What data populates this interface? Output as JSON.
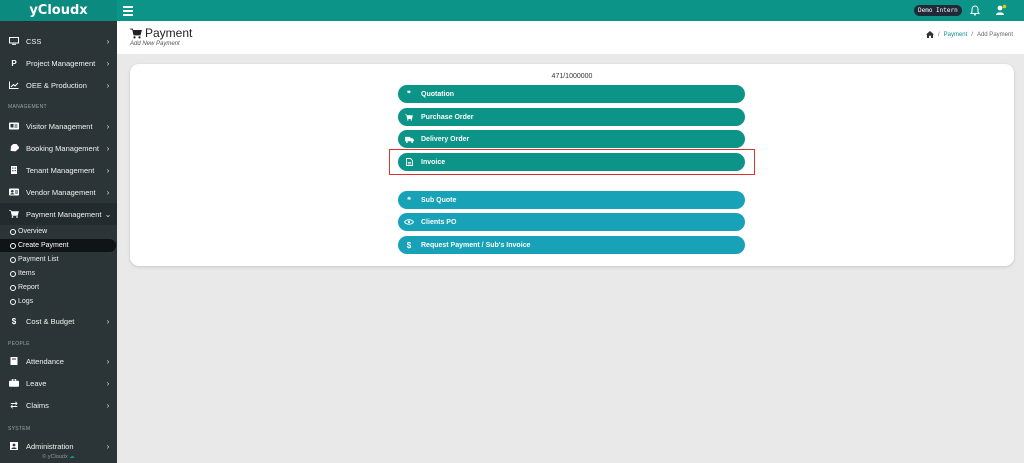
{
  "topbar": {
    "brand": "yCloudx",
    "user_label": "Demo Intern"
  },
  "sidebar": {
    "items_top": [
      {
        "label": "CSS",
        "icon": "monitor-icon"
      },
      {
        "label": "Project Management",
        "icon": "p-icon"
      },
      {
        "label": "OEE & Production",
        "icon": "chart-line-icon"
      }
    ],
    "section_management": "MANAGEMENT",
    "items_management": [
      {
        "label": "Visitor Management",
        "icon": "id-card-icon"
      },
      {
        "label": "Booking Management",
        "icon": "tag-icon"
      },
      {
        "label": "Tenant Management",
        "icon": "building-icon"
      },
      {
        "label": "Vendor Management",
        "icon": "contact-card-icon"
      },
      {
        "label": "Payment Management",
        "icon": "cart-icon"
      }
    ],
    "payment_sub": [
      "Overview",
      "Create Payment",
      "Payment List",
      "Items",
      "Report",
      "Logs"
    ],
    "cost_budget": "Cost & Budget",
    "section_people": "PEOPLE",
    "items_people": [
      {
        "label": "Attendance",
        "icon": "book-icon"
      },
      {
        "label": "Leave",
        "icon": "briefcase-icon"
      },
      {
        "label": "Claims",
        "icon": "exchange-icon"
      }
    ],
    "section_system": "SYSTEM",
    "administration": "Administration",
    "copyright": "© yCloudx"
  },
  "header": {
    "title": "Payment",
    "subtitle": "Add New Payment",
    "breadcrumb": [
      "Payment",
      "Add Payment"
    ]
  },
  "card": {
    "counter": "471/1000000",
    "primary_buttons": [
      {
        "label": "Quotation",
        "icon": "quote-icon"
      },
      {
        "label": "Purchase Order",
        "icon": "cart-icon"
      },
      {
        "label": "Delivery Order",
        "icon": "truck-icon"
      },
      {
        "label": "Invoice",
        "icon": "file-icon"
      }
    ],
    "secondary_buttons": [
      {
        "label": "Sub Quote",
        "icon": "quote-icon"
      },
      {
        "label": "Clients PO",
        "icon": "eye-icon"
      },
      {
        "label": "Request Payment / Sub's Invoice",
        "icon": "dollar-icon"
      }
    ]
  },
  "colors": {
    "primary": "#0d9488",
    "secondary": "#17a2b8",
    "sidebar": "#2b3538",
    "highlight": "#d9342b"
  }
}
